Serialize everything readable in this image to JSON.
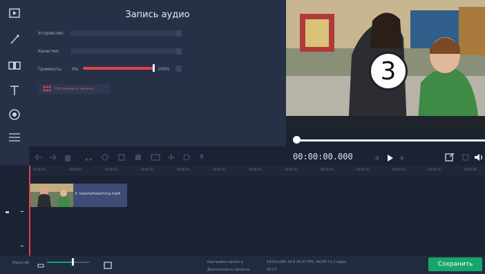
{
  "panel": {
    "title": "Запись аудио",
    "device_label": "Устройство:",
    "quality_label": "Качество:",
    "volume_label": "Громкость:",
    "volume_min": "0%",
    "volume_max": "100%",
    "volume_level": 1.0,
    "record_button": "Остановить запись"
  },
  "preview": {
    "countdown": "3",
    "seek_position": 0.0
  },
  "player": {
    "timecode": "00:00:00.000"
  },
  "timeline": {
    "ticks": [
      "00:00:00",
      "00:00:05",
      "00:00:10",
      "00:00:15",
      "00:00:20",
      "00:00:25",
      "00:00:30",
      "00:00:35",
      "00:00:40",
      "00:00:45",
      "00:00:50",
      "00:00:55",
      "00:01:00"
    ],
    "clip_label": "3. teacherteaching.mp4"
  },
  "status": {
    "scale_label": "Масштаб:",
    "settings_label": "Настройки проекта:",
    "settings_value": "1920x1080 16:9 29.97 FPS, 44100 Гц Стерео",
    "duration_label": "Длительность проекта:",
    "duration_value": "00:13",
    "zoom_level": 0.6,
    "save_button": "Сохранить"
  },
  "colors": {
    "accent_red": "#e2434b",
    "save_green": "#16a66b"
  }
}
